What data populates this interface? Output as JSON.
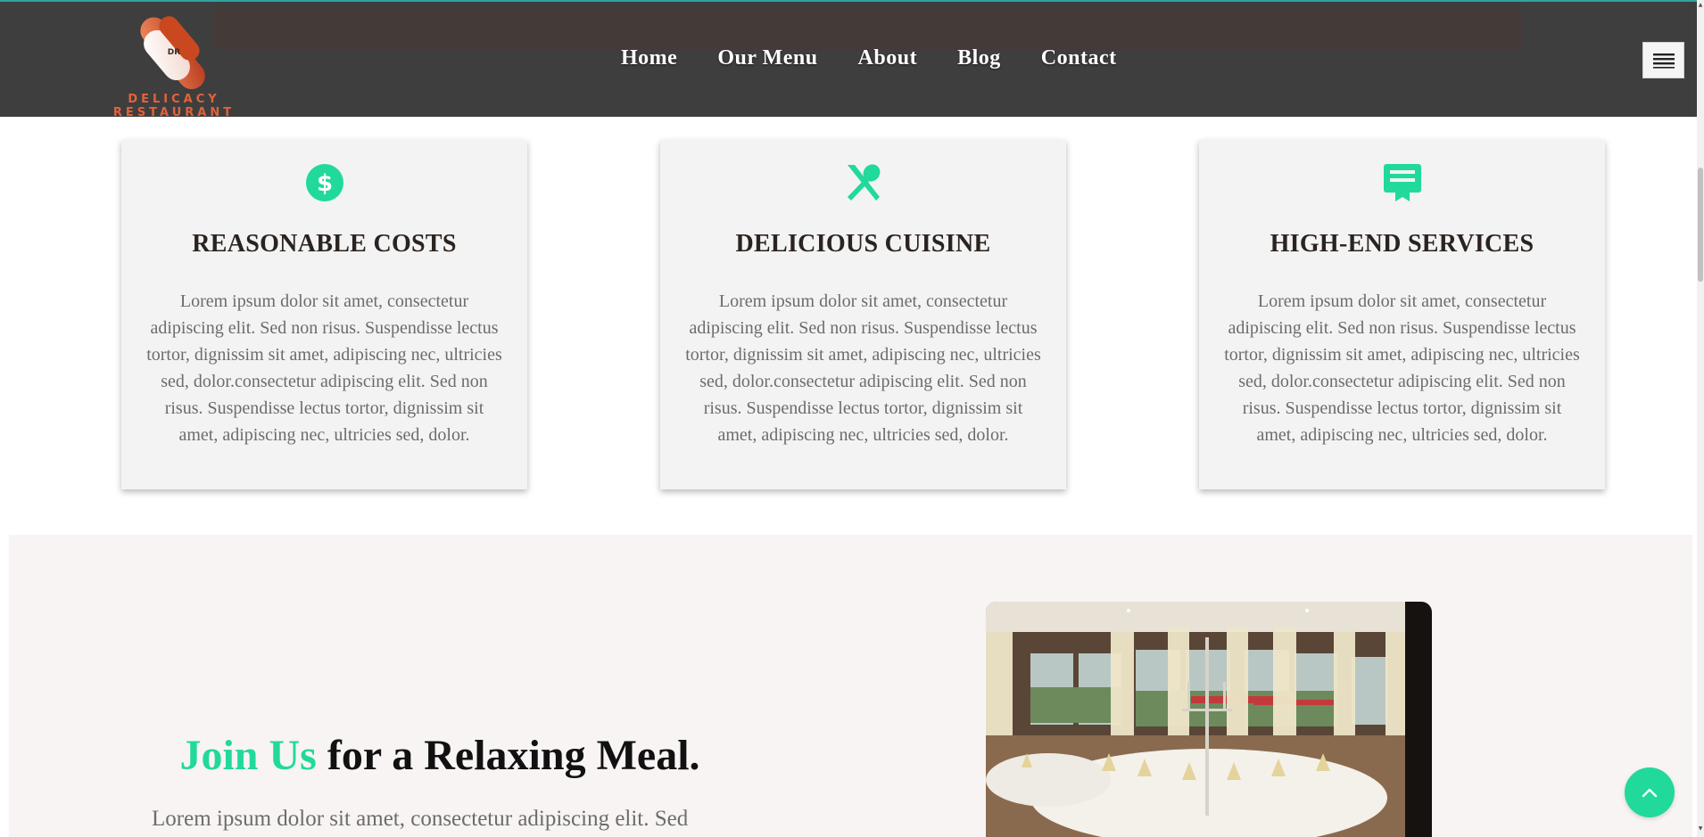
{
  "brand": {
    "logo_monogram": "DR",
    "name": "DELICACY RESTAURANT"
  },
  "nav": {
    "items": [
      {
        "label": "Home"
      },
      {
        "label": "Our Menu"
      },
      {
        "label": "About"
      },
      {
        "label": "Blog"
      },
      {
        "label": "Contact"
      }
    ],
    "menu_toggle_icon": "hamburger-menu-icon"
  },
  "features": [
    {
      "icon": "dollar-circle-icon",
      "title": "REASONABLE COSTS",
      "text": "Lorem ipsum dolor sit amet, consectetur adipiscing elit. Sed non risus. Suspendisse lectus tortor, dignissim sit amet, adipiscing nec, ultricies sed, dolor.consectetur adipiscing elit. Sed non risus. Suspendisse lectus tortor, dignissim sit amet, adipiscing nec, ultricies sed, dolor."
    },
    {
      "icon": "utensils-icon",
      "title": "DELICIOUS CUISINE",
      "text": "Lorem ipsum dolor sit amet, consectetur adipiscing elit. Sed non risus. Suspendisse lectus tortor, dignissim sit amet, adipiscing nec, ultricies sed, dolor.consectetur adipiscing elit. Sed non risus. Suspendisse lectus tortor, dignissim sit amet, adipiscing nec, ultricies sed, dolor."
    },
    {
      "icon": "service-bell-icon",
      "title": "HIGH-END SERVICES",
      "text": "Lorem ipsum dolor sit amet, consectetur adipiscing elit. Sed non risus. Suspendisse lectus tortor, dignissim sit amet, adipiscing nec, ultricies sed, dolor.consectetur adipiscing elit. Sed non risus. Suspendisse lectus tortor, dignissim sit amet, adipiscing nec, ultricies sed, dolor."
    }
  ],
  "join": {
    "heading_accent": "Join Us",
    "heading_rest": " for a Relaxing Meal.",
    "text": "Lorem ipsum dolor sit amet, consectetur adipiscing elit. Sed"
  },
  "colors": {
    "accent": "#21d99b",
    "header_bg": "#3e3e3e",
    "brand_orange": "#e3623b",
    "card_bg": "#f3f3f3",
    "section_bg": "#f8f4f3"
  },
  "back_to_top_icon": "chevron-up-icon"
}
